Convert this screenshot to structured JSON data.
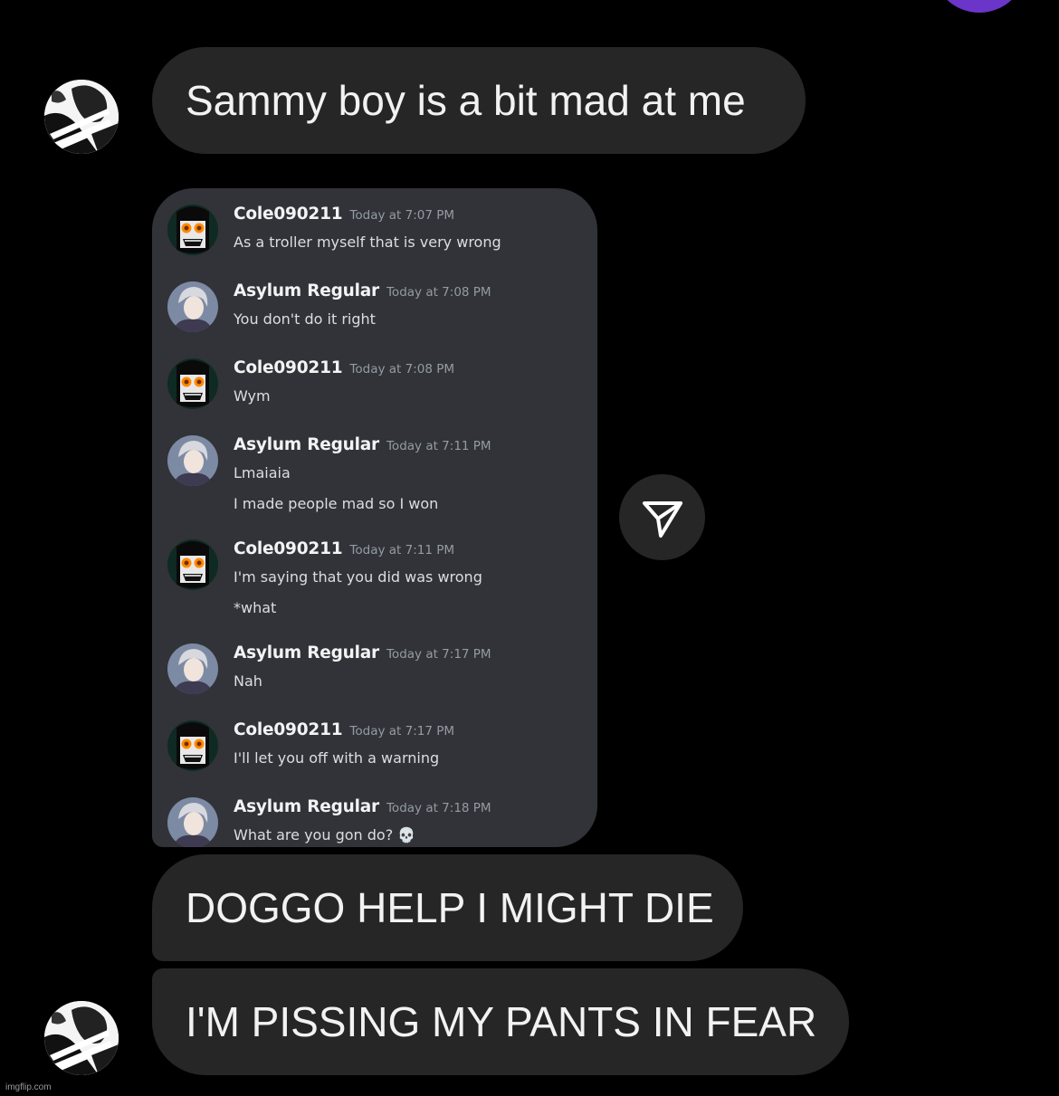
{
  "messages": {
    "m1": "Sammy boy is a bit mad at me",
    "m3": "DOGGO HELP I MIGHT DIE",
    "m4": "I'M PISSING MY PANTS IN FEAR"
  },
  "screenshot": {
    "entries": [
      {
        "name": "Cole090211",
        "time": "Today at 7:07 PM",
        "lines": [
          "As a troller myself that is very wrong"
        ]
      },
      {
        "name": "Asylum Regular",
        "time": "Today at 7:08 PM",
        "lines": [
          "You don't do it right"
        ]
      },
      {
        "name": "Cole090211",
        "time": "Today at 7:08 PM",
        "lines": [
          "Wym"
        ]
      },
      {
        "name": "Asylum Regular",
        "time": "Today at 7:11 PM",
        "lines": [
          "Lmaiaia",
          "I made people mad so I won"
        ]
      },
      {
        "name": "Cole090211",
        "time": "Today at 7:11 PM",
        "lines": [
          "I'm saying that you did was wrong",
          "*what"
        ]
      },
      {
        "name": "Asylum Regular",
        "time": "Today at 7:17 PM",
        "lines": [
          "Nah"
        ]
      },
      {
        "name": "Cole090211",
        "time": "Today at 7:17 PM",
        "lines": [
          "I'll let you off with a warning"
        ]
      },
      {
        "name": "Asylum Regular",
        "time": "Today at 7:18 PM",
        "lines": [
          "What are you gon do? 💀"
        ]
      }
    ]
  },
  "icons": {
    "share": "paper-plane-icon",
    "skull": "skull-emoji"
  },
  "colors": {
    "background": "#000000",
    "bubble": "#262626",
    "discord_bg": "#313338",
    "accent_avatar": "#6b35c9"
  },
  "watermark": "imgflip.com"
}
